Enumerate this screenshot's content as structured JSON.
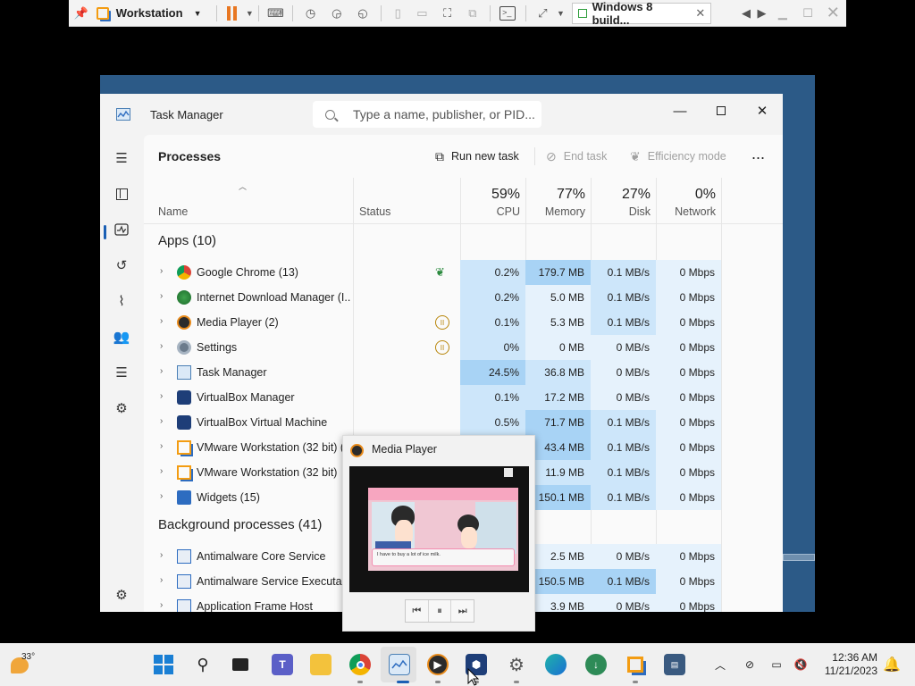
{
  "vm_toolbar": {
    "product": "Workstation",
    "tab_title": "Windows 8 build...",
    "icons": [
      "pin-icon",
      "vmware-logo-icon",
      "pause-icon",
      "send-keys-icon",
      "snapshot-icon",
      "revert-snapshot-icon",
      "snapshot-manager-icon",
      "console-view-icon",
      "full-screen-icon",
      "unity-icon",
      "terminal-icon",
      "stretch-icon"
    ]
  },
  "task_manager": {
    "title": "Task Manager",
    "search_placeholder": "Type a name, publisher, or PID...",
    "nav_icons": [
      "hamburger-icon",
      "processes-icon",
      "performance-icon",
      "app-history-icon",
      "startup-apps-icon",
      "users-icon",
      "details-icon",
      "services-icon",
      "settings-icon"
    ],
    "page_title": "Processes",
    "commands": {
      "run_new_task": "Run new task",
      "end_task": "End task",
      "efficiency_mode": "Efficiency mode",
      "more": "..."
    },
    "columns": {
      "name": "Name",
      "status": "Status",
      "cpu_pct": "59%",
      "cpu": "CPU",
      "memory_pct": "77%",
      "memory": "Memory",
      "disk_pct": "27%",
      "disk": "Disk",
      "network_pct": "0%",
      "network": "Network"
    },
    "groups": {
      "apps": "Apps (10)",
      "background": "Background processes (41)"
    },
    "apps": [
      {
        "name": "Google Chrome (13)",
        "status": "efficiency",
        "cpu": "0.2%",
        "memory": "179.7 MB",
        "disk": "0.1 MB/s",
        "network": "0 Mbps",
        "icon": "chrome-icon"
      },
      {
        "name": "Internet Download Manager (I...",
        "status": "",
        "cpu": "0.2%",
        "memory": "5.0 MB",
        "disk": "0.1 MB/s",
        "network": "0 Mbps",
        "icon": "idm-icon"
      },
      {
        "name": "Media Player (2)",
        "status": "suspended",
        "cpu": "0.1%",
        "memory": "5.3 MB",
        "disk": "0.1 MB/s",
        "network": "0 Mbps",
        "icon": "media-player-icon"
      },
      {
        "name": "Settings",
        "status": "suspended",
        "cpu": "0%",
        "memory": "0 MB",
        "disk": "0 MB/s",
        "network": "0 Mbps",
        "icon": "settings-gear-icon"
      },
      {
        "name": "Task Manager",
        "status": "",
        "cpu": "24.5%",
        "memory": "36.8 MB",
        "disk": "0 MB/s",
        "network": "0 Mbps",
        "icon": "task-manager-icon"
      },
      {
        "name": "VirtualBox Manager",
        "status": "",
        "cpu": "0.1%",
        "memory": "17.2 MB",
        "disk": "0 MB/s",
        "network": "0 Mbps",
        "icon": "virtualbox-icon"
      },
      {
        "name": "VirtualBox Virtual Machine",
        "status": "",
        "cpu": "0.5%",
        "memory": "71.7 MB",
        "disk": "0.1 MB/s",
        "network": "0 Mbps",
        "icon": "virtualbox-icon"
      },
      {
        "name": "VMware Workstation (32 bit) (3",
        "status": "",
        "cpu": "",
        "memory": "43.4 MB",
        "disk": "0.1 MB/s",
        "network": "0 Mbps",
        "icon": "vmware-icon"
      },
      {
        "name": "VMware Workstation (32 bit)",
        "status": "",
        "cpu": "",
        "memory": "11.9 MB",
        "disk": "0.1 MB/s",
        "network": "0 Mbps",
        "icon": "vmware-icon"
      },
      {
        "name": "Widgets (15)",
        "status": "",
        "cpu": "",
        "memory": "150.1 MB",
        "disk": "0.1 MB/s",
        "network": "0 Mbps",
        "icon": "widgets-icon"
      }
    ],
    "background": [
      {
        "name": "Antimalware Core Service",
        "cpu": "",
        "memory": "2.5 MB",
        "disk": "0 MB/s",
        "network": "0 Mbps",
        "icon": "service-icon"
      },
      {
        "name": "Antimalware Service Executable",
        "cpu": "",
        "memory": "150.5 MB",
        "disk": "0.1 MB/s",
        "network": "0 Mbps",
        "icon": "service-icon"
      },
      {
        "name": "Application Frame Host",
        "cpu": "",
        "memory": "3.9 MB",
        "disk": "0 MB/s",
        "network": "0 Mbps",
        "icon": "service-icon"
      }
    ]
  },
  "media_player_preview": {
    "title": "Media Player",
    "video_caption": "I have to buy a lot of ice milk.",
    "controls": [
      "previous-icon",
      "pause-icon",
      "next-icon"
    ]
  },
  "taskbar": {
    "weather_temp": "33°",
    "time": "12:36 AM",
    "date": "11/21/2023",
    "pinned": [
      "start-icon",
      "search-icon",
      "task-view-icon",
      "teams-icon",
      "file-explorer-icon",
      "chrome-icon",
      "task-manager-icon",
      "media-player-icon",
      "virtualbox-icon",
      "settings-icon",
      "edge-icon",
      "idm-icon",
      "vmware-icon",
      "performance-monitor-icon"
    ],
    "tray": [
      "chevron-up-icon",
      "network-icon",
      "display-icon",
      "volume-muted-icon",
      "notification-bell-icon"
    ]
  },
  "colors": {
    "heat_light": "#fbeeb8",
    "heat_mid": "#f9dd87",
    "heat_blue_light": "#e6f2fc",
    "heat_blue": "#cde6fa",
    "heat_blue_strong": "#a8d3f5",
    "accent": "#1a5fb4"
  }
}
